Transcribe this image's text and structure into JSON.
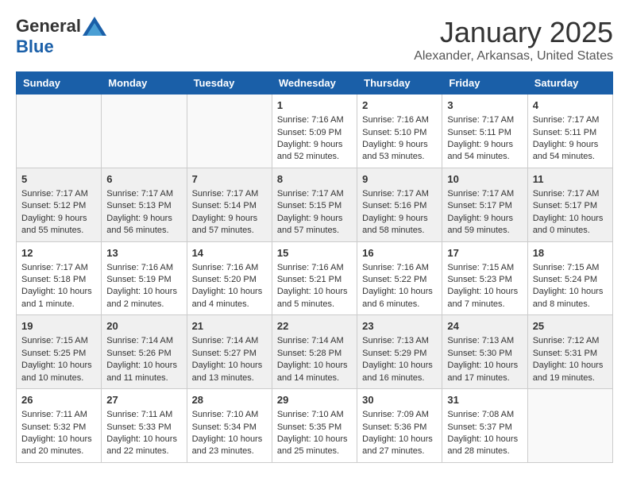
{
  "logo": {
    "general": "General",
    "blue": "Blue"
  },
  "title": "January 2025",
  "location": "Alexander, Arkansas, United States",
  "weekdays": [
    "Sunday",
    "Monday",
    "Tuesday",
    "Wednesday",
    "Thursday",
    "Friday",
    "Saturday"
  ],
  "weeks": [
    [
      {
        "day": "",
        "info": ""
      },
      {
        "day": "",
        "info": ""
      },
      {
        "day": "",
        "info": ""
      },
      {
        "day": "1",
        "info": "Sunrise: 7:16 AM\nSunset: 5:09 PM\nDaylight: 9 hours and 52 minutes."
      },
      {
        "day": "2",
        "info": "Sunrise: 7:16 AM\nSunset: 5:10 PM\nDaylight: 9 hours and 53 minutes."
      },
      {
        "day": "3",
        "info": "Sunrise: 7:17 AM\nSunset: 5:11 PM\nDaylight: 9 hours and 54 minutes."
      },
      {
        "day": "4",
        "info": "Sunrise: 7:17 AM\nSunset: 5:11 PM\nDaylight: 9 hours and 54 minutes."
      }
    ],
    [
      {
        "day": "5",
        "info": "Sunrise: 7:17 AM\nSunset: 5:12 PM\nDaylight: 9 hours and 55 minutes."
      },
      {
        "day": "6",
        "info": "Sunrise: 7:17 AM\nSunset: 5:13 PM\nDaylight: 9 hours and 56 minutes."
      },
      {
        "day": "7",
        "info": "Sunrise: 7:17 AM\nSunset: 5:14 PM\nDaylight: 9 hours and 57 minutes."
      },
      {
        "day": "8",
        "info": "Sunrise: 7:17 AM\nSunset: 5:15 PM\nDaylight: 9 hours and 57 minutes."
      },
      {
        "day": "9",
        "info": "Sunrise: 7:17 AM\nSunset: 5:16 PM\nDaylight: 9 hours and 58 minutes."
      },
      {
        "day": "10",
        "info": "Sunrise: 7:17 AM\nSunset: 5:17 PM\nDaylight: 9 hours and 59 minutes."
      },
      {
        "day": "11",
        "info": "Sunrise: 7:17 AM\nSunset: 5:17 PM\nDaylight: 10 hours and 0 minutes."
      }
    ],
    [
      {
        "day": "12",
        "info": "Sunrise: 7:17 AM\nSunset: 5:18 PM\nDaylight: 10 hours and 1 minute."
      },
      {
        "day": "13",
        "info": "Sunrise: 7:16 AM\nSunset: 5:19 PM\nDaylight: 10 hours and 2 minutes."
      },
      {
        "day": "14",
        "info": "Sunrise: 7:16 AM\nSunset: 5:20 PM\nDaylight: 10 hours and 4 minutes."
      },
      {
        "day": "15",
        "info": "Sunrise: 7:16 AM\nSunset: 5:21 PM\nDaylight: 10 hours and 5 minutes."
      },
      {
        "day": "16",
        "info": "Sunrise: 7:16 AM\nSunset: 5:22 PM\nDaylight: 10 hours and 6 minutes."
      },
      {
        "day": "17",
        "info": "Sunrise: 7:15 AM\nSunset: 5:23 PM\nDaylight: 10 hours and 7 minutes."
      },
      {
        "day": "18",
        "info": "Sunrise: 7:15 AM\nSunset: 5:24 PM\nDaylight: 10 hours and 8 minutes."
      }
    ],
    [
      {
        "day": "19",
        "info": "Sunrise: 7:15 AM\nSunset: 5:25 PM\nDaylight: 10 hours and 10 minutes."
      },
      {
        "day": "20",
        "info": "Sunrise: 7:14 AM\nSunset: 5:26 PM\nDaylight: 10 hours and 11 minutes."
      },
      {
        "day": "21",
        "info": "Sunrise: 7:14 AM\nSunset: 5:27 PM\nDaylight: 10 hours and 13 minutes."
      },
      {
        "day": "22",
        "info": "Sunrise: 7:14 AM\nSunset: 5:28 PM\nDaylight: 10 hours and 14 minutes."
      },
      {
        "day": "23",
        "info": "Sunrise: 7:13 AM\nSunset: 5:29 PM\nDaylight: 10 hours and 16 minutes."
      },
      {
        "day": "24",
        "info": "Sunrise: 7:13 AM\nSunset: 5:30 PM\nDaylight: 10 hours and 17 minutes."
      },
      {
        "day": "25",
        "info": "Sunrise: 7:12 AM\nSunset: 5:31 PM\nDaylight: 10 hours and 19 minutes."
      }
    ],
    [
      {
        "day": "26",
        "info": "Sunrise: 7:11 AM\nSunset: 5:32 PM\nDaylight: 10 hours and 20 minutes."
      },
      {
        "day": "27",
        "info": "Sunrise: 7:11 AM\nSunset: 5:33 PM\nDaylight: 10 hours and 22 minutes."
      },
      {
        "day": "28",
        "info": "Sunrise: 7:10 AM\nSunset: 5:34 PM\nDaylight: 10 hours and 23 minutes."
      },
      {
        "day": "29",
        "info": "Sunrise: 7:10 AM\nSunset: 5:35 PM\nDaylight: 10 hours and 25 minutes."
      },
      {
        "day": "30",
        "info": "Sunrise: 7:09 AM\nSunset: 5:36 PM\nDaylight: 10 hours and 27 minutes."
      },
      {
        "day": "31",
        "info": "Sunrise: 7:08 AM\nSunset: 5:37 PM\nDaylight: 10 hours and 28 minutes."
      },
      {
        "day": "",
        "info": ""
      }
    ]
  ]
}
